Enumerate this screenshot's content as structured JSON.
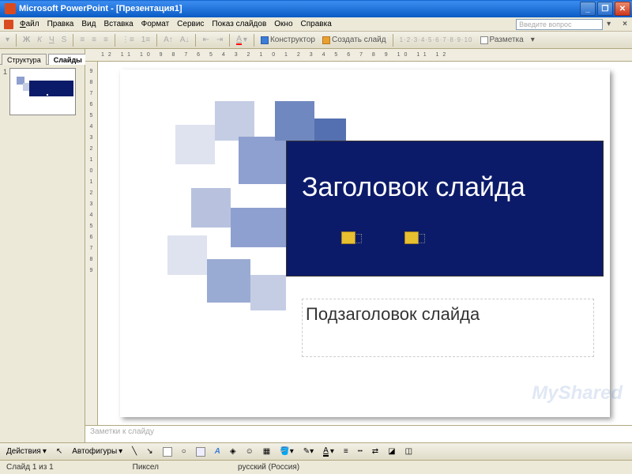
{
  "titlebar": {
    "app": "Microsoft PowerPoint",
    "doc": "[Презентация1]"
  },
  "menus": {
    "file": "Файл",
    "edit": "Правка",
    "view": "Вид",
    "insert": "Вставка",
    "format": "Формат",
    "tools": "Сервис",
    "slideshow": "Показ слайдов",
    "window": "Окно",
    "help": "Справка",
    "help_placeholder": "Введите вопрос"
  },
  "toolbar": {
    "designer": "Конструктор",
    "new_slide": "Создать слайд",
    "layout": "Разметка"
  },
  "sidebar": {
    "tabs": {
      "outline": "Структура",
      "slides": "Слайды"
    },
    "thumbs": [
      {
        "num": "1"
      }
    ]
  },
  "slide": {
    "title": "Заголовок слайда",
    "subtitle": "Подзаголовок слайда"
  },
  "notes": {
    "placeholder": "Заметки к слайду"
  },
  "drawbar": {
    "actions": "Действия",
    "autoshapes": "Автофигуры"
  },
  "status": {
    "slide_pos": "Слайд 1 из 1",
    "theme": "Пиксел",
    "lang": "русский (Россия)"
  },
  "watermark": "MyShared"
}
